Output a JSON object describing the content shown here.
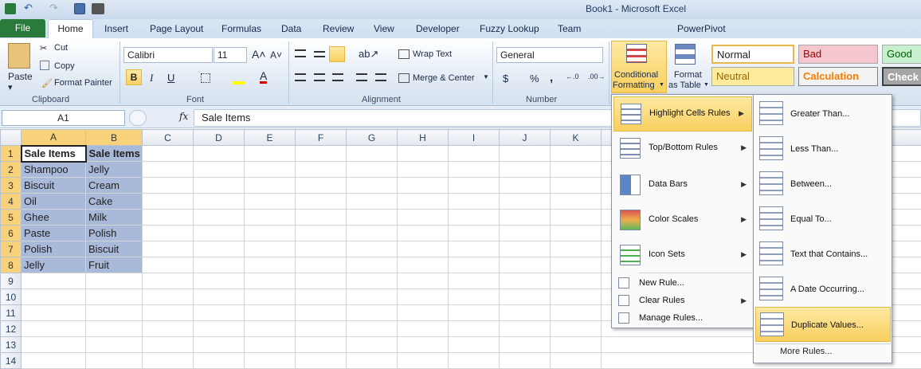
{
  "window": {
    "title": "Book1  -  Microsoft Excel"
  },
  "tabs": [
    "File",
    "Home",
    "Insert",
    "Page Layout",
    "Formulas",
    "Data",
    "Review",
    "View",
    "Developer",
    "Fuzzy Lookup",
    "Team",
    "PowerPivot"
  ],
  "clipboard": {
    "paste": "Paste",
    "cut": "Cut",
    "copy": "Copy",
    "format_painter": "Format Painter",
    "label": "Clipboard"
  },
  "font": {
    "name": "Calibri",
    "size": "11",
    "bold": "B",
    "italic": "I",
    "underline": "U",
    "label": "Font"
  },
  "alignment": {
    "wrap_text": "Wrap Text",
    "merge_center": "Merge & Center",
    "label": "Alignment"
  },
  "number": {
    "format": "General",
    "currency": "$",
    "percent": "%",
    "comma": ",",
    "label": "Number"
  },
  "styles_buttons": {
    "conditional_line1": "Conditional",
    "conditional_line2": "Formatting",
    "format_table_line1": "Format",
    "format_table_line2": "as Table"
  },
  "cell_styles": [
    {
      "name": "Normal",
      "bg": "#ffffff",
      "color": "#000000"
    },
    {
      "name": "Bad",
      "bg": "#f4c7ce",
      "color": "#9c0006"
    },
    {
      "name": "Good",
      "bg": "#c6efce",
      "color": "#006100"
    },
    {
      "name": "Neutral",
      "bg": "#ffeb9c",
      "color": "#9c6500"
    },
    {
      "name": "Calculation",
      "bg": "#f2f2f2",
      "color": "#fa7d00"
    },
    {
      "name": "Check Cell",
      "bg": "#a5a5a5",
      "color": "#ffffff"
    }
  ],
  "formula_bar": {
    "name_box": "A1",
    "fx": "fx",
    "content": "Sale Items"
  },
  "columns": [
    "A",
    "B",
    "C",
    "D",
    "E",
    "F",
    "G",
    "H",
    "I",
    "J",
    "K"
  ],
  "rows": [
    {
      "n": "1",
      "a": "Sale Items",
      "b": "Sale Items"
    },
    {
      "n": "2",
      "a": "Shampoo",
      "b": "Jelly"
    },
    {
      "n": "3",
      "a": "Biscuit",
      "b": "Cream"
    },
    {
      "n": "4",
      "a": "Oil",
      "b": "Cake"
    },
    {
      "n": "5",
      "a": "Ghee",
      "b": "Milk"
    },
    {
      "n": "6",
      "a": "Paste",
      "b": "Polish"
    },
    {
      "n": "7",
      "a": "Polish",
      "b": "Biscuit"
    },
    {
      "n": "8",
      "a": "Jelly",
      "b": "Fruit"
    },
    {
      "n": "9",
      "a": "",
      "b": ""
    },
    {
      "n": "10",
      "a": "",
      "b": ""
    },
    {
      "n": "11",
      "a": "",
      "b": ""
    },
    {
      "n": "12",
      "a": "",
      "b": ""
    },
    {
      "n": "13",
      "a": "",
      "b": ""
    },
    {
      "n": "14",
      "a": "",
      "b": ""
    }
  ],
  "cf_menu": {
    "items": [
      "Highlight Cells Rules",
      "Top/Bottom Rules",
      "Data Bars",
      "Color Scales",
      "Icon Sets"
    ],
    "small_items": [
      "New Rule...",
      "Clear Rules",
      "Manage Rules..."
    ]
  },
  "submenu": {
    "items": [
      "Greater Than...",
      "Less Than...",
      "Between...",
      "Equal To...",
      "Text that Contains...",
      "A Date Occurring...",
      "Duplicate Values..."
    ],
    "more": "More Rules..."
  },
  "colors": {
    "accent": "#f9cf5e",
    "file_tab": "#2a7a3b",
    "selection": "#a9b9d9"
  }
}
